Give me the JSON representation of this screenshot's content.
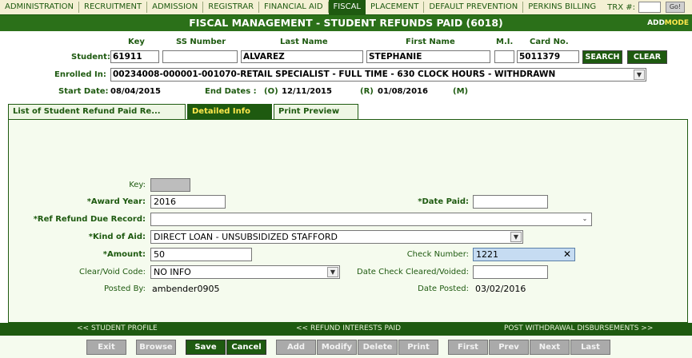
{
  "topnav": {
    "items": [
      "ADMINISTRATION",
      "RECRUITMENT",
      "ADMISSION",
      "REGISTRAR",
      "FINANCIAL AID",
      "FISCAL",
      "PLACEMENT",
      "DEFAULT PREVENTION",
      "PERKINS BILLING"
    ],
    "active": "FISCAL",
    "trx_label": "TRX #:",
    "go_label": "Go!"
  },
  "titlebar": {
    "title": "FISCAL MANAGEMENT - STUDENT REFUNDS PAID (6018)",
    "add": "ADD",
    "mode": "MODE"
  },
  "student": {
    "headers": {
      "key": "Key",
      "ssn": "SS Number",
      "last": "Last Name",
      "first": "First Name",
      "mi": "M.I.",
      "card": "Card No."
    },
    "label": "Student:",
    "key": "61911",
    "ssn": "",
    "last_name": "ALVAREZ",
    "first_name": "STEPHANIE",
    "mi": "",
    "card_no": "5011379",
    "search_label": "SEARCH",
    "clear_label": "CLEAR"
  },
  "enrollment": {
    "label": "Enrolled In:",
    "value": "00234008-000001-001070-RETAIL SPECIALIST - FULL TIME - 630 CLOCK HOURS - WITHDRAWN",
    "start_label": "Start Date:",
    "start": "08/04/2015",
    "end_label": "End Dates :",
    "o_label": "(O)",
    "o_date": "12/11/2015",
    "r_label": "(R)",
    "r_date": "01/08/2016",
    "m_label": "(M)"
  },
  "tabs": [
    "List of Student Refund Paid Re...",
    "Detailed Info",
    "Print Preview"
  ],
  "form": {
    "key_label": "Key:",
    "award_year_label": "*Award Year:",
    "award_year": "2016",
    "date_paid_label": "*Date Paid:",
    "date_paid": "",
    "ref_refund_label": "*Ref Refund Due Record:",
    "ref_refund": "",
    "kind_of_aid_label": "*Kind of Aid:",
    "kind_of_aid": "DIRECT LOAN - UNSUBSIDIZED STAFFORD",
    "amount_label": "*Amount:",
    "amount": "50",
    "check_number_label": "Check Number:",
    "check_number": "1221",
    "clear_void_label": "Clear/Void Code:",
    "clear_void": "NO INFO",
    "date_cleared_label": "Date Check Cleared/Voided:",
    "date_cleared": "",
    "posted_by_label": "Posted By:",
    "posted_by": "ambender0905",
    "date_posted_label": "Date Posted:",
    "date_posted": "03/02/2016"
  },
  "bottomnav": {
    "left": "<< STUDENT PROFILE",
    "center": "<< REFUND INTERESTS PAID",
    "right": "POST WITHDRAWAL DISBURSEMENTS >>"
  },
  "buttons": {
    "exit": "Exit",
    "browse": "Browse",
    "save": "Save",
    "cancel": "Cancel",
    "add": "Add",
    "modify": "Modify",
    "delete": "Delete",
    "print": "Print",
    "first": "First",
    "prev": "Prev",
    "next": "Next",
    "last": "Last"
  },
  "colors": {
    "primary_green": "#1e5a10",
    "mode_yellow": "#ffe84c",
    "highlight_blue": "#c6dcf2"
  }
}
